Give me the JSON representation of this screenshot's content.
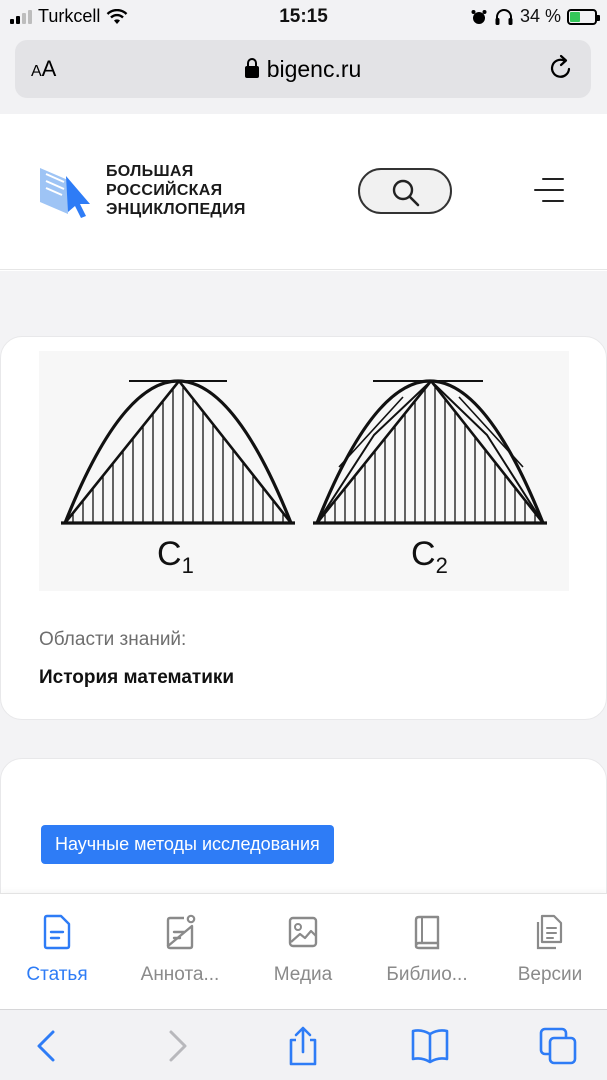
{
  "status_bar": {
    "carrier": "Turkcell",
    "time": "15:15",
    "battery": "34 %",
    "battery_level_percent": 34
  },
  "address_bar": {
    "text_size_label_small": "A",
    "text_size_label_large": "A",
    "url": "bigenc.ru"
  },
  "header": {
    "logo_line1": "БОЛЬШАЯ",
    "logo_line2": "РОССИЙСКАЯ",
    "logo_line3": "ЭНЦИКЛОПЕДИЯ"
  },
  "figure": {
    "label_c1": "C",
    "label_c1_sub": "1",
    "label_c2": "C",
    "label_c2_sub": "2"
  },
  "knowledge": {
    "label": "Области знаний:",
    "value": "История математики"
  },
  "tag": {
    "label": "Научные методы исследования"
  },
  "tabs": [
    {
      "label": "Статья",
      "icon": "article-icon",
      "active": true
    },
    {
      "label": "Аннота...",
      "icon": "annotation-icon",
      "active": false
    },
    {
      "label": "Медиа",
      "icon": "media-icon",
      "active": false
    },
    {
      "label": "Библио...",
      "icon": "bibliography-icon",
      "active": false
    },
    {
      "label": "Версии",
      "icon": "versions-icon",
      "active": false
    }
  ],
  "colors": {
    "accent": "#2e7cf6",
    "logo_blue": "#5aa0f0",
    "battery_green": "#34c759"
  }
}
